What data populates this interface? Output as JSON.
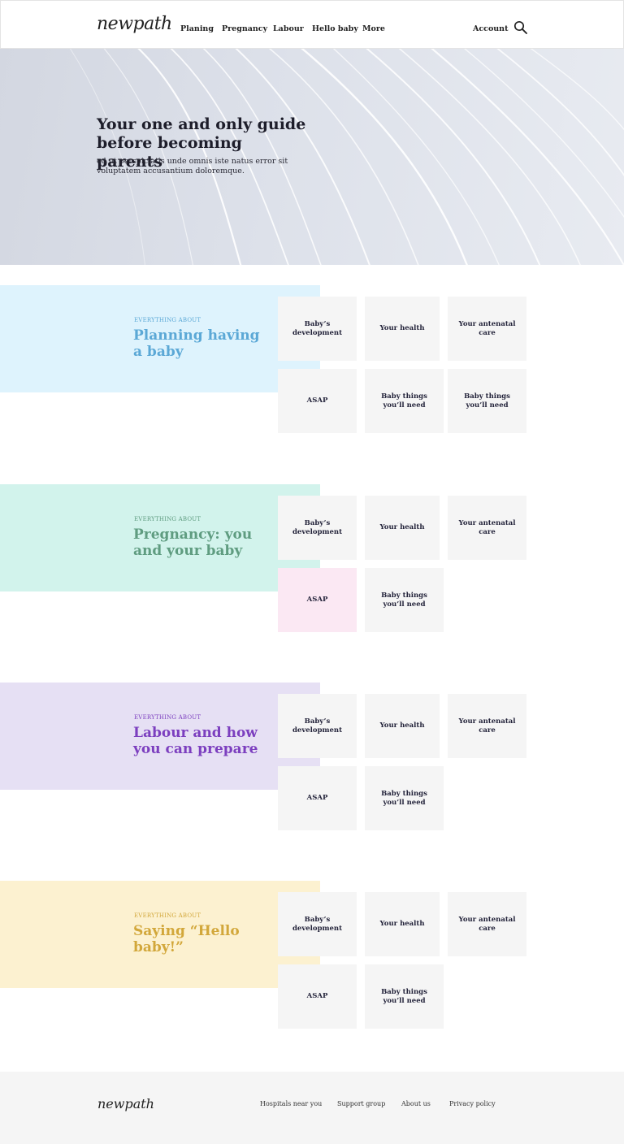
{
  "header": {
    "logo": "newpath",
    "nav": [
      "Planing",
      "Pregnancy",
      "Labour",
      "Hello baby",
      "More"
    ],
    "account": "Account"
  },
  "hero": {
    "title": "Your one and only guide before becoming parents",
    "subtitle": "ed ut perspiciatis unde omnis iste natus error sit voluptatem accusantium doloremque."
  },
  "sections": [
    {
      "eyebrow": "EVERYTHING ABOUT",
      "title": "Planning having a baby",
      "panel_color": "#def3fd",
      "accent_color": "#5ba8d6",
      "cards": [
        "Baby’s development",
        "Your health",
        "Your antenatal care",
        "ASAP",
        "Baby things you’ll need",
        "Baby things you’ll need"
      ]
    },
    {
      "eyebrow": "EVERYTHING ABOUT",
      "title": "Pregnancy: you and your baby",
      "panel_color": "#d2f3ec",
      "accent_color": "#5f9c80",
      "cards": [
        "Baby’s development",
        "Your health",
        "Your antenatal care",
        "ASAP",
        "Baby things you’ll need"
      ]
    },
    {
      "eyebrow": "EVERYTHING ABOUT",
      "title": "Labour and how you can prepare",
      "panel_color": "#e6e0f4",
      "accent_color": "#7c3fbf",
      "cards": [
        "Baby’s development",
        "Your health",
        "Your antenatal care",
        "ASAP",
        "Baby things you’ll need"
      ]
    },
    {
      "eyebrow": "EVERYTHING ABOUT",
      "title": "Saying “Hello baby!”",
      "panel_color": "#fcf1d0",
      "accent_color": "#d2a73a",
      "cards": [
        "Baby’s development",
        "Your health",
        "Your antenatal care",
        "ASAP",
        "Baby things you’ll need"
      ]
    }
  ],
  "highlight_card_color": "#fbe8f3",
  "footer": {
    "logo": "newpath",
    "links": [
      "Hospitals near you",
      "Support group",
      "About us",
      "Privacy policy"
    ]
  }
}
